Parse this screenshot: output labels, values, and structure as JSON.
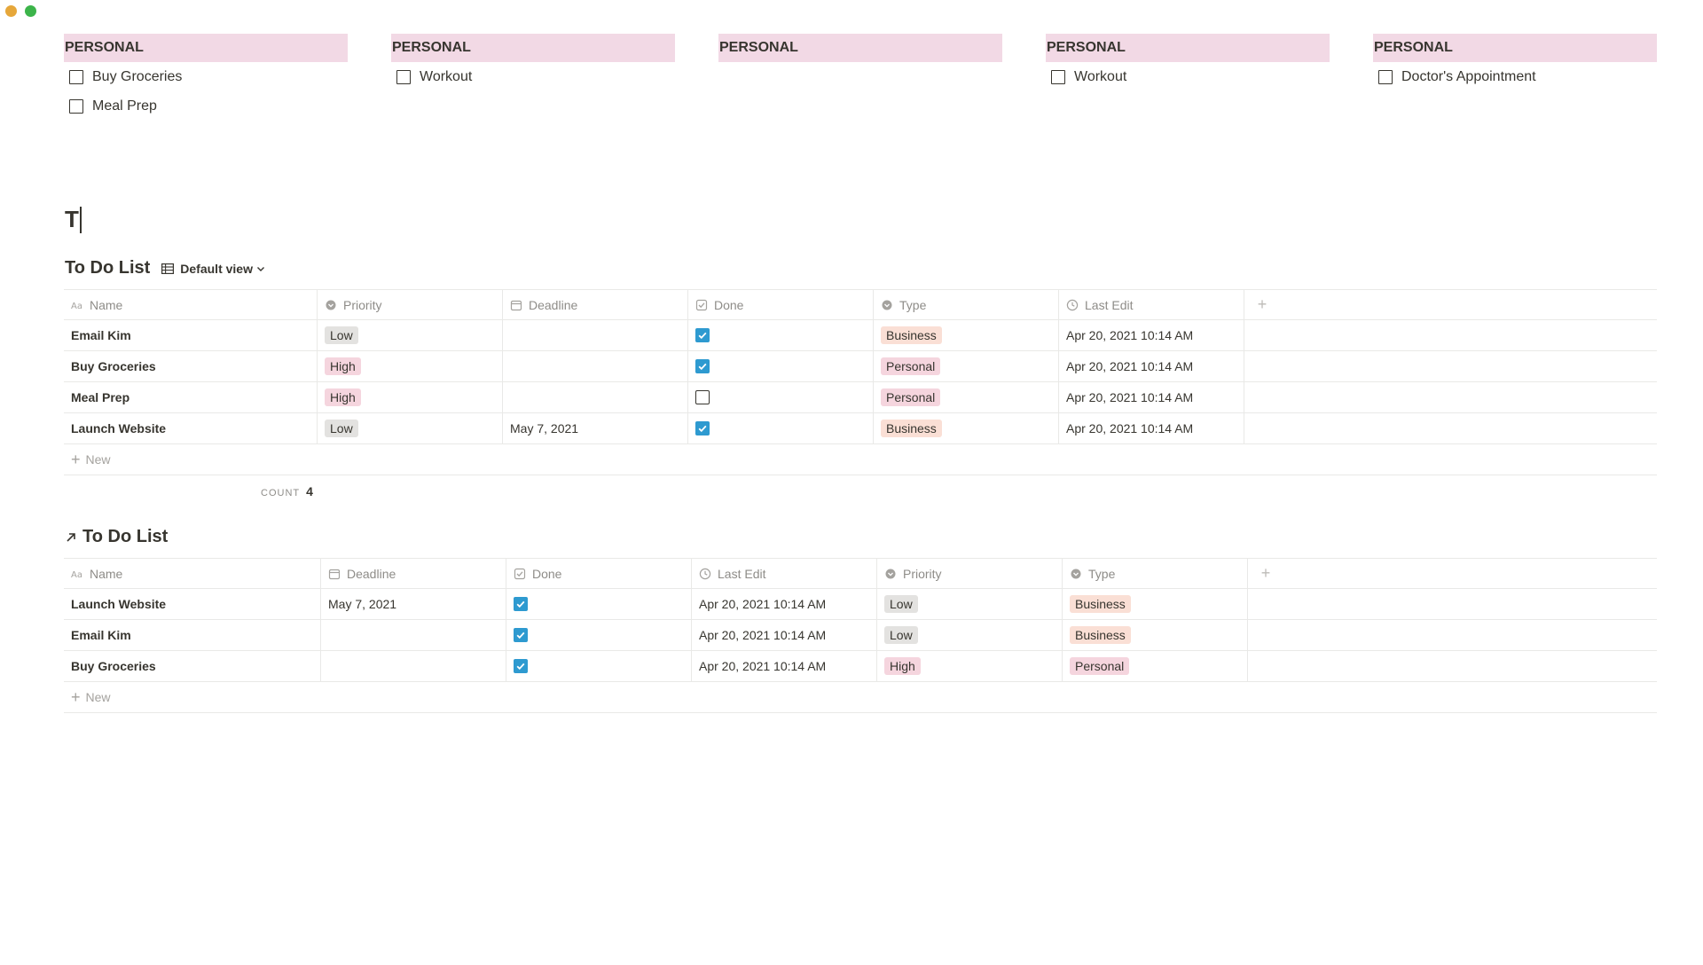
{
  "board": {
    "columns": [
      {
        "header": "PERSONAL",
        "cards": [
          "Buy Groceries",
          "Meal Prep"
        ]
      },
      {
        "header": "PERSONAL",
        "cards": [
          "Workout"
        ]
      },
      {
        "header": "PERSONAL",
        "cards": []
      },
      {
        "header": "PERSONAL",
        "cards": [
          "Workout"
        ]
      },
      {
        "header": "PERSONAL",
        "cards": [
          "Doctor's Appointment"
        ]
      }
    ]
  },
  "heading": {
    "text": "T"
  },
  "table1": {
    "title": "To Do List",
    "view_label": "Default view",
    "columns": [
      "Name",
      "Priority",
      "Deadline",
      "Done",
      "Type",
      "Last Edit"
    ],
    "rows": [
      {
        "name": "Email Kim",
        "priority": "Low",
        "deadline": "",
        "done": true,
        "type": "Business",
        "last_edit": "Apr 20, 2021 10:14 AM"
      },
      {
        "name": "Buy Groceries",
        "priority": "High",
        "deadline": "",
        "done": true,
        "type": "Personal",
        "last_edit": "Apr 20, 2021 10:14 AM"
      },
      {
        "name": "Meal Prep",
        "priority": "High",
        "deadline": "",
        "done": false,
        "type": "Personal",
        "last_edit": "Apr 20, 2021 10:14 AM"
      },
      {
        "name": "Launch Website",
        "priority": "Low",
        "deadline": "May 7, 2021",
        "done": true,
        "type": "Business",
        "last_edit": "Apr 20, 2021 10:14 AM"
      }
    ],
    "new_label": "New",
    "count_label": "COUNT",
    "count_value": "4"
  },
  "table2": {
    "title": "To Do List",
    "columns": [
      "Name",
      "Deadline",
      "Done",
      "Last Edit",
      "Priority",
      "Type"
    ],
    "rows": [
      {
        "name": "Launch Website",
        "deadline": "May 7, 2021",
        "done": true,
        "last_edit": "Apr 20, 2021 10:14 AM",
        "priority": "Low",
        "type": "Business"
      },
      {
        "name": "Email Kim",
        "deadline": "",
        "done": true,
        "last_edit": "Apr 20, 2021 10:14 AM",
        "priority": "Low",
        "type": "Business"
      },
      {
        "name": "Buy Groceries",
        "deadline": "",
        "done": true,
        "last_edit": "Apr 20, 2021 10:14 AM",
        "priority": "High",
        "type": "Personal"
      }
    ],
    "new_label": "New"
  },
  "colors": {
    "board_header": "#f2d9e5",
    "checkbox_on": "#2e9ad0",
    "tag_low": "#e3e2e0",
    "tag_high": "#f5d5de",
    "tag_business": "#fadfd5",
    "tag_personal": "#f5d5de"
  },
  "icons": {
    "name": "text-aa-icon",
    "priority": "select-circle-icon",
    "deadline": "calendar-icon",
    "done": "checkbox-icon",
    "type": "select-circle-icon",
    "last_edit": "clock-icon",
    "view": "table-grid-icon",
    "linked": "arrow-up-right-icon",
    "add": "plus-icon"
  }
}
